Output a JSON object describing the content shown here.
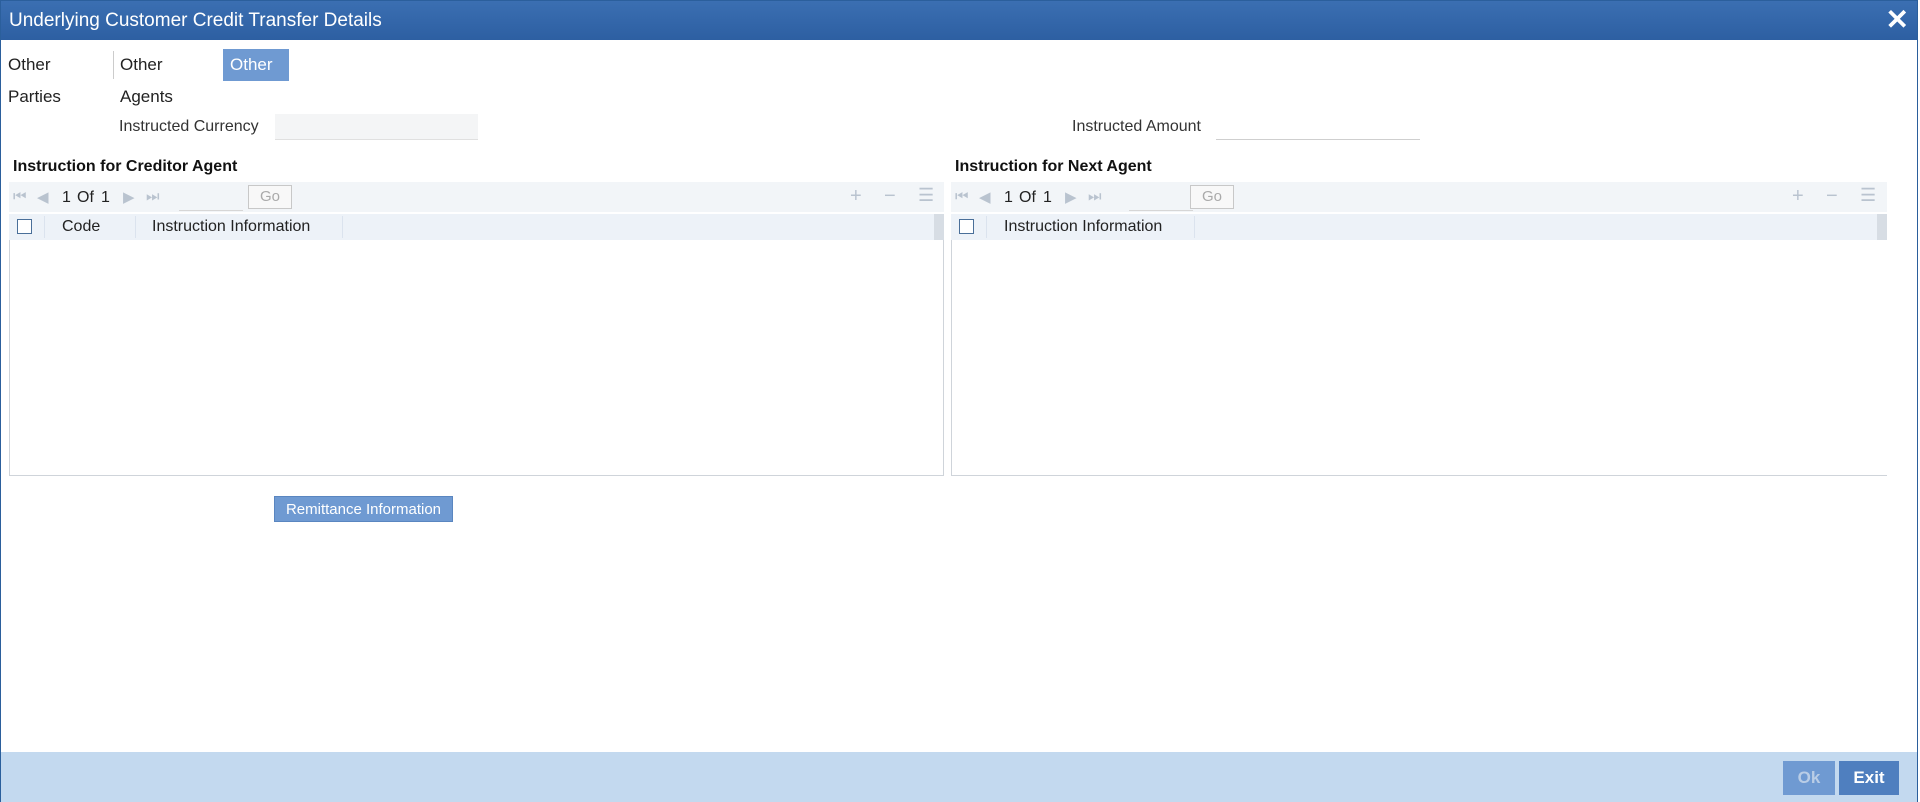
{
  "window": {
    "title": "Underlying Customer Credit Transfer Details",
    "close_glyph": "✕"
  },
  "tabs": [
    {
      "label": "Other Parties",
      "active": false
    },
    {
      "label": "Other Agents",
      "active": false
    },
    {
      "label": "Other Details",
      "active": true
    }
  ],
  "fields": {
    "instructed_currency_label": "Instructed Currency",
    "instructed_currency_value": "",
    "instructed_amount_label": "Instructed Amount",
    "instructed_amount_value": ""
  },
  "creditor_agent_grid": {
    "title": "Instruction for Creditor Agent",
    "page_current": "1",
    "page_of": "Of",
    "page_total": "1",
    "go_label": "Go",
    "columns": [
      "Code",
      "Instruction Information"
    ],
    "rows": []
  },
  "next_agent_grid": {
    "title": "Instruction for Next Agent",
    "page_current": "1",
    "page_of": "Of",
    "page_total": "1",
    "go_label": "Go",
    "columns": [
      "Instruction Information"
    ],
    "rows": []
  },
  "buttons": {
    "remittance_information": "Remittance Information",
    "ok": "Ok",
    "exit": "Exit"
  },
  "icons": {
    "first_page": "first-page-icon",
    "prev_page": "prev-page-icon",
    "next_page": "next-page-icon",
    "last_page": "last-page-icon",
    "add_row": "plus-icon",
    "delete_row": "minus-icon",
    "single_view": "list-view-icon"
  },
  "colors": {
    "titlebar": "#2d5fa2",
    "accent": "#6f9ad2",
    "footer": "#c3d9ef"
  }
}
